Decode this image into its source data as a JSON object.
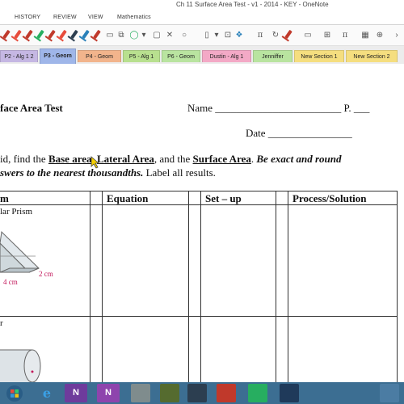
{
  "window": {
    "title": "Ch 11 Surface Area Test - v1 - 2014 - KEY - OneNote"
  },
  "menu": {
    "items": [
      "HISTORY",
      "REVIEW",
      "VIEW",
      "Mathematics"
    ]
  },
  "toolbar": {
    "icons": [
      "pen-icon",
      "pen-icon",
      "pen-icon",
      "pen-icon",
      "pen-icon",
      "pen-icon",
      "pen-icon",
      "pen-icon",
      "pen-icon",
      "pen-icon",
      "pen-icon",
      "eraser-icon",
      "copy-icon",
      "lasso-icon",
      "shapes-icon",
      "close-shape-icon",
      "circle-shape-icon",
      "rectangle-icon",
      "arrange-icon",
      "rotate-icon",
      "pi-icon",
      "pen-icon",
      "pi-icon",
      "math-icon",
      "add-icon",
      "chevron-right-icon"
    ],
    "pi_label": "π",
    "pi2_label": "π"
  },
  "tabs": [
    {
      "label": "P2 - Alg 1 2",
      "color": "#c5b7e3"
    },
    {
      "label": "P3 - Geom",
      "color": "#9fb6e9",
      "active": true
    },
    {
      "label": "P4 - Geom",
      "color": "#f2b48c"
    },
    {
      "label": "P5 - Alg 1",
      "color": "#b8e08f"
    },
    {
      "label": "P6 - Geom",
      "color": "#b9e4a0"
    },
    {
      "label": "Dustin - Alg 1",
      "color": "#f3a9c6"
    },
    {
      "label": "Jenniffer",
      "color": "#b9e4a0"
    },
    {
      "label": "New Section 1",
      "color": "#f5de7f"
    },
    {
      "label": "New Section 2",
      "color": "#f5de7f"
    }
  ],
  "doc": {
    "title": "face Area Test",
    "name_label": "Name ________________________ P.  ___",
    "date_label": "Date ________________",
    "instr_pre": "id, find the ",
    "instr_base": "Base area",
    "instr_comma1": ", ",
    "instr_lateral": "Lateral Area",
    "instr_and": ", and the ",
    "instr_surface": "Surface Area",
    "instr_period": ".  ",
    "instr_italic1": "Be exact and round",
    "instr_line2_italic": "swers to the nearest thousandths.",
    "instr_line2_rest": "  Label all results.",
    "col_solid": "m",
    "col_equation": "Equation",
    "col_setup": "Set – up",
    "col_process": "Process/Solution",
    "row1_label": "lar Prism",
    "row1_dim1": "2 cm",
    "row1_dim2": "4 cm",
    "row2_label": "r"
  },
  "taskbar": {
    "apps": [
      "start-button",
      "internet-explorer-icon",
      "onenote-icon",
      "onenote-icon",
      "app-icon",
      "app-icon",
      "app-icon",
      "app-icon",
      "app-icon",
      "app-icon"
    ],
    "onenote_label": "N"
  }
}
